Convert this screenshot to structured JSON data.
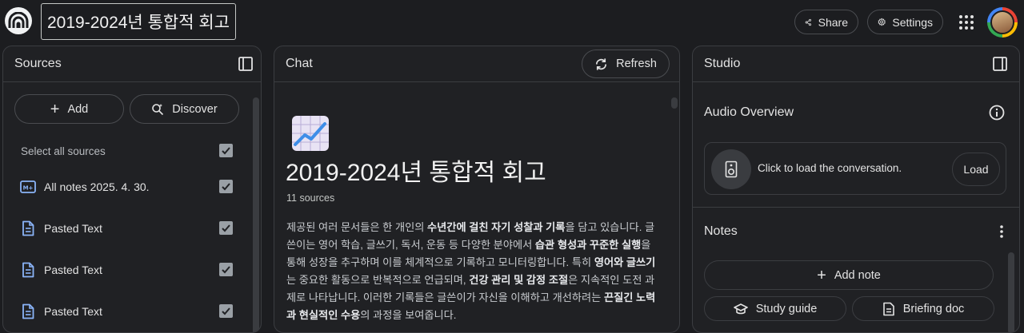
{
  "header": {
    "notebook_title": "2019-2024년 통합적 회고",
    "share_label": "Share",
    "settings_label": "Settings"
  },
  "sources": {
    "title": "Sources",
    "add_label": "Add",
    "discover_label": "Discover",
    "select_all_label": "Select all sources",
    "items": [
      {
        "label": "All notes 2025. 4. 30.",
        "icon": "memo-icon"
      },
      {
        "label": "Pasted Text",
        "icon": "document-icon"
      },
      {
        "label": "Pasted Text",
        "icon": "document-icon"
      },
      {
        "label": "Pasted Text",
        "icon": "document-icon"
      }
    ]
  },
  "chat": {
    "title": "Chat",
    "refresh_label": "Refresh",
    "notebook_title": "2019-2024년 통합적 회고",
    "source_count": "11 sources",
    "summary": {
      "s1": "제공된 여러 문서들은 한 개인의 ",
      "b1": "수년간에 걸친 자기 성찰과 기록",
      "s2": "을 담고 있습니다. 글쓴이는 영어 학습, 글쓰기, 독서, 운동 등 다양한 분야에서 ",
      "b2": "습관 형성과 꾸준한 실행",
      "s3": "을 통해 성장을 추구하며 이를 체계적으로 기록하고 모니터링합니다. 특히 ",
      "b3": "영어와 글쓰기",
      "s4": "는 중요한 활동으로 반복적으로 언급되며, ",
      "b4": "건강 관리 및 감정 조절",
      "s5": "은 지속적인 도전 과제로 나타납니다. 이러한 기록들은 글쓴이가 자신을 이해하고 개선하려는 ",
      "b5": "끈질긴 노력과 현실적인 수용",
      "s6": "의 과정을 보여줍니다."
    }
  },
  "studio": {
    "title": "Studio",
    "audio_overview_label": "Audio Overview",
    "audio_prompt": "Click to load the conversation.",
    "load_label": "Load",
    "notes_label": "Notes",
    "add_note_label": "Add note",
    "study_guide_label": "Study guide",
    "briefing_doc_label": "Briefing doc"
  },
  "colors": {
    "background": "#1c1d20",
    "panel": "#202124",
    "border": "#3b3d41",
    "source_icon": "#8ab4f8"
  }
}
